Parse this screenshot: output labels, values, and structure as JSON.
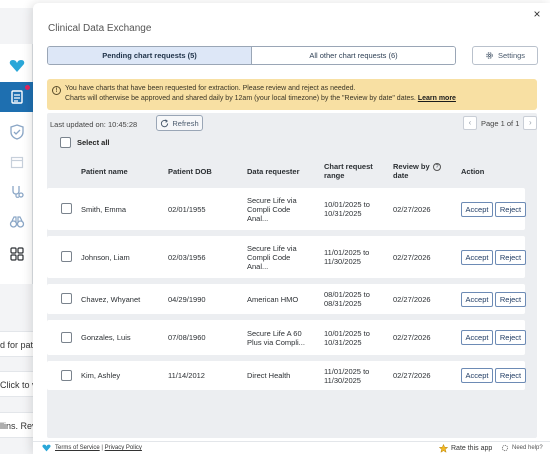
{
  "background": {
    "topright_text": "· · · · · · ·",
    "rows": [
      "d for pati",
      "Click to vi",
      "llins. Revi"
    ]
  },
  "modal": {
    "title": "Clinical Data Exchange",
    "close": "×"
  },
  "tabs": [
    {
      "label": "Pending chart requests (5)",
      "active": true
    },
    {
      "label": "All other chart requests (6)",
      "active": false
    }
  ],
  "settings_label": "Settings",
  "alert": {
    "line1": "You have charts that have been requested for extraction. Please review and reject as needed.",
    "line2": "Charts will otherwise be approved and shared daily by 12am (your local timezone) by the \"Review by date\" dates.",
    "link": "Learn more"
  },
  "last_updated": "Last updated on: 10:45:28",
  "refresh_label": "Refresh",
  "pager": {
    "text": "Page 1 of 1",
    "prev": "‹",
    "next": "›"
  },
  "select_all_label": "Select all",
  "columns": {
    "patient_name": "Patient name",
    "patient_dob": "Patient DOB",
    "data_requester": "Data requester",
    "chart_request_range": "Chart request range",
    "review_by_date": "Review by date",
    "action": "Action"
  },
  "rows": [
    {
      "name": "Smith, Emma",
      "dob": "02/01/1955",
      "requester": [
        "Secure Life via",
        "Compli Code",
        "Anal..."
      ],
      "range": [
        "10/01/2025 to",
        "10/31/2025"
      ],
      "review": "02/27/2026"
    },
    {
      "name": "Johnson, Liam",
      "dob": "02/03/1956",
      "requester": [
        "Secure Life via",
        "Compli Code",
        "Anal..."
      ],
      "range": [
        "11/01/2025 to",
        "11/30/2025"
      ],
      "review": "02/27/2026"
    },
    {
      "name": "Chavez, Whyanet",
      "dob": "04/29/1990",
      "requester": [
        "American HMO"
      ],
      "range": [
        "08/01/2025 to",
        "08/31/2025"
      ],
      "review": "02/27/2026"
    },
    {
      "name": "Gonzales, Luis",
      "dob": "07/08/1960",
      "requester": [
        "Secure Life A 60",
        "Plus via Compli..."
      ],
      "range": [
        "10/01/2025 to",
        "10/31/2025"
      ],
      "review": "02/27/2026"
    },
    {
      "name": "Kim, Ashley",
      "dob": "11/14/2012",
      "requester": [
        "Direct Health"
      ],
      "range": [
        "11/01/2025 to",
        "11/30/2025"
      ],
      "review": "02/27/2026"
    }
  ],
  "actions": {
    "accept": "Accept",
    "reject": "Reject"
  },
  "footer": {
    "terms": "Terms of Service",
    "sep": " | ",
    "privacy": "Privacy Policy",
    "rate": "Rate this app",
    "help": "Need help?"
  },
  "colors": {
    "accent": "#2b6cb0",
    "alert_bg": "#f8e0a3",
    "active_tab_bg": "#dde7f7",
    "brand": "#2aa7d8"
  }
}
